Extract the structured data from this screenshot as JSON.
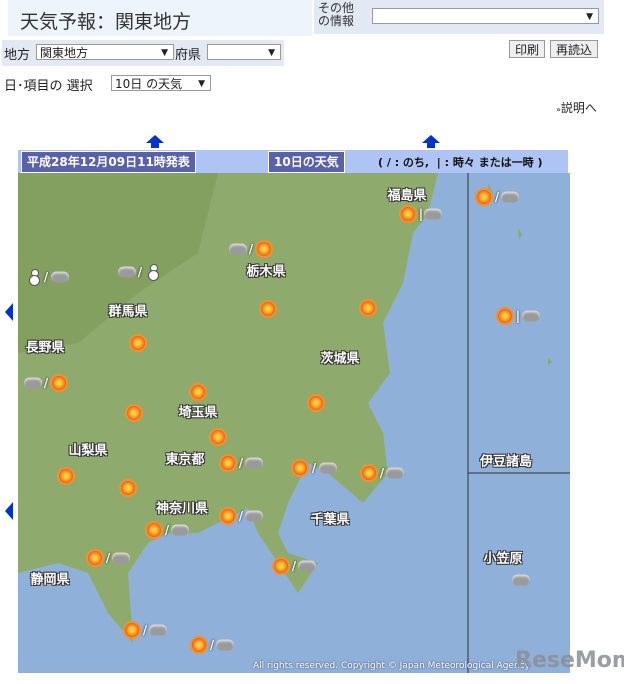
{
  "header": {
    "title": "天気予報：関東地方",
    "other_label": "その他の情報",
    "other_value": ""
  },
  "controls": {
    "region_label": "地方",
    "region_value": "関東地方",
    "pref_label": "府県",
    "pref_value": "",
    "print": "印刷",
    "reload": "再読込",
    "select_label": "日･項目の 選択",
    "select_value": "10日 の天気",
    "help_link": "説明へ"
  },
  "map": {
    "issued": "平成28年12月09日11時発表",
    "day_title": "10日の天気",
    "legend": "( / : のち,  | : 時々 または一時 )",
    "copyright": "All rights reserved. Copyright © Japan Meteorological Agency",
    "labels": {
      "fukushima": "福島県",
      "tochigi": "栃木県",
      "gunma": "群馬県",
      "nagano": "長野県",
      "ibaraki": "茨城県",
      "saitama": "埼玉県",
      "yamanashi": "山梨県",
      "tokyo": "東京都",
      "kanagawa": "神奈川県",
      "chiba": "千葉県",
      "shizuoka": "静岡県",
      "izu": "伊豆諸島",
      "ogasawara": "小笠原"
    },
    "sep_later": "/",
    "sep_sometimes": "|"
  },
  "watermark": "ReseMom"
}
